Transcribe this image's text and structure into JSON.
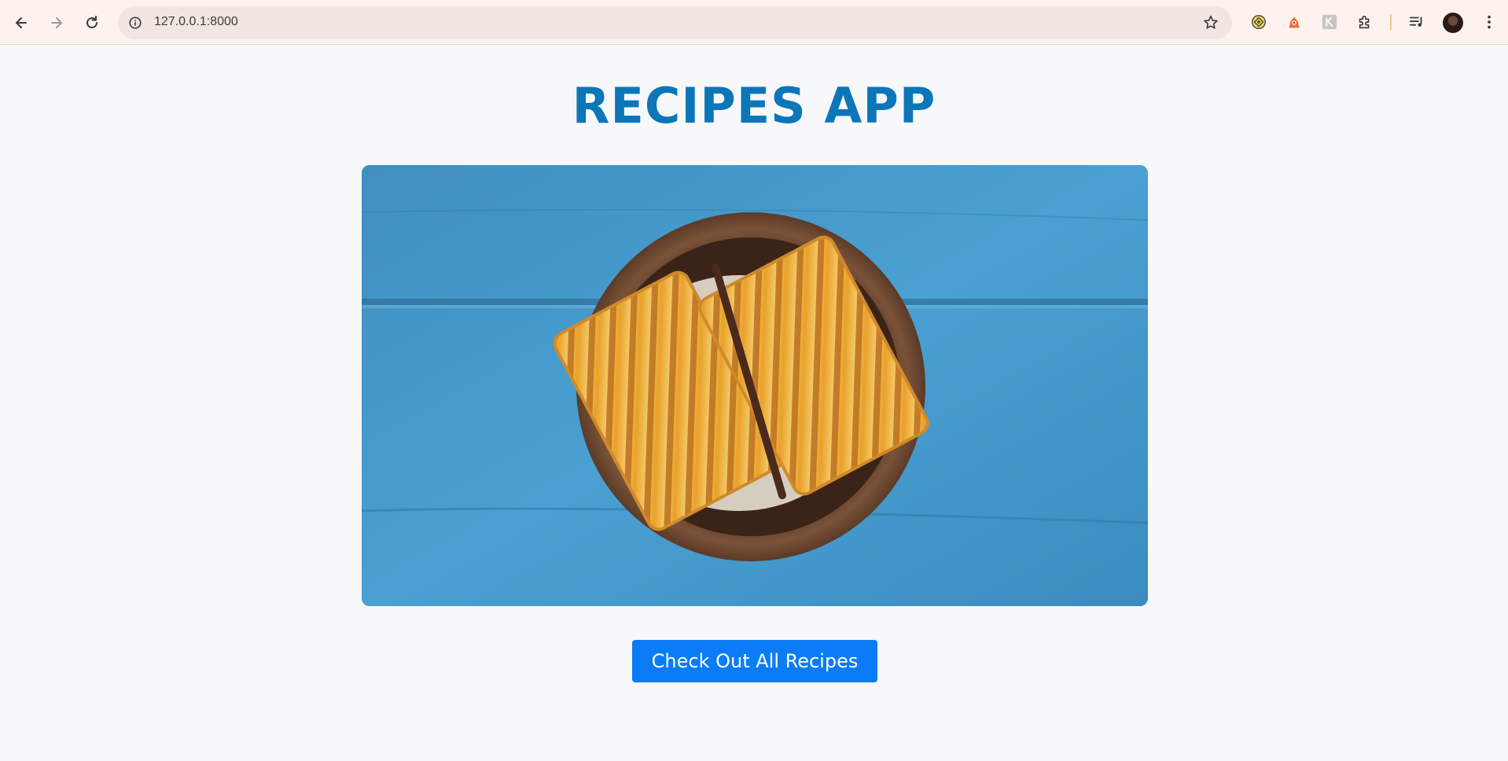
{
  "browser": {
    "url": "127.0.0.1:8000",
    "icons": {
      "back": "arrow-left-icon",
      "forward": "arrow-right-icon",
      "reload": "reload-icon",
      "site_info": "info-icon",
      "bookmark": "star-icon",
      "extensions": "puzzle-icon",
      "media": "media-queue-icon",
      "menu": "more-vert-icon"
    }
  },
  "page": {
    "title": "RECIPES APP",
    "cta_label": "Check Out All Recipes",
    "colors": {
      "title": "#0b76b8",
      "button": "#0b7cf6",
      "background": "#f7f8fa"
    }
  }
}
